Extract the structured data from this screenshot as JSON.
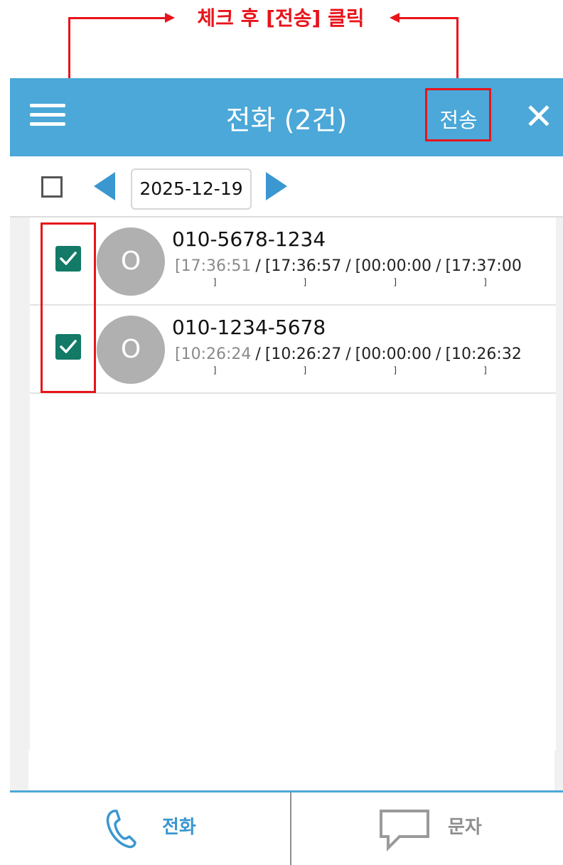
{
  "annotation": {
    "label": "체크 후 [전송] 클릭"
  },
  "header": {
    "title": "전화 (2건)",
    "send_label": "전송",
    "close_symbol": "✕"
  },
  "toolbar": {
    "date": "2025-12-19"
  },
  "calls": [
    {
      "checked": true,
      "avatar": "O",
      "phone": "010-5678-1234",
      "times": [
        "[17:36:51",
        "[17:36:57",
        "[00:00:00",
        "[17:37:00"
      ]
    },
    {
      "checked": true,
      "avatar": "O",
      "phone": "010-1234-5678",
      "times": [
        "[10:26:24",
        "[10:26:27",
        "[00:00:00",
        "[10:26:32"
      ]
    }
  ],
  "time_separator": "/",
  "time_closer": "]",
  "tabs": [
    {
      "label": "전화",
      "icon": "phone-icon",
      "active": true
    },
    {
      "label": "문자",
      "icon": "chat-icon",
      "active": false
    }
  ],
  "colors": {
    "annotation": "#e8141b",
    "header": "#4ba8d8",
    "checkbox": "#127a67",
    "avatar": "#b0b0b0",
    "active_tab": "#3a97d0",
    "inactive_tab": "#8f8f8f"
  }
}
